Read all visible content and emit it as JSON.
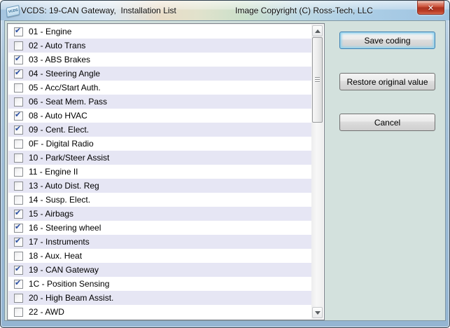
{
  "window": {
    "logo_text": "VCDS",
    "title": "VCDS: 19-CAN Gateway,  Installation List",
    "copyright": "Image Copyright (C) Ross-Tech, LLC",
    "close_glyph": "✕"
  },
  "list": {
    "items": [
      {
        "label": "01 - Engine",
        "checked": true
      },
      {
        "label": "02 - Auto Trans",
        "checked": false
      },
      {
        "label": "03 - ABS Brakes",
        "checked": true
      },
      {
        "label": "04 - Steering Angle",
        "checked": true
      },
      {
        "label": "05 - Acc/Start Auth.",
        "checked": false
      },
      {
        "label": "06 - Seat Mem. Pass",
        "checked": false
      },
      {
        "label": "08 - Auto HVAC",
        "checked": true
      },
      {
        "label": "09 - Cent. Elect.",
        "checked": true
      },
      {
        "label": "0F - Digital Radio",
        "checked": false
      },
      {
        "label": "10 - Park/Steer Assist",
        "checked": false
      },
      {
        "label": "11 - Engine II",
        "checked": false
      },
      {
        "label": "13 - Auto Dist. Reg",
        "checked": false
      },
      {
        "label": "14 - Susp. Elect.",
        "checked": false
      },
      {
        "label": "15 - Airbags",
        "checked": true
      },
      {
        "label": "16 - Steering wheel",
        "checked": true
      },
      {
        "label": "17 - Instruments",
        "checked": true
      },
      {
        "label": "18 - Aux. Heat",
        "checked": false
      },
      {
        "label": "19 - CAN Gateway",
        "checked": true
      },
      {
        "label": "1C - Position Sensing",
        "checked": true
      },
      {
        "label": "20 - High Beam Assist.",
        "checked": false
      },
      {
        "label": "22 - AWD",
        "checked": false
      }
    ],
    "partial_row_visible": true
  },
  "actions": {
    "save": "Save coding",
    "restore": "Restore original value",
    "cancel": "Cancel"
  },
  "colors": {
    "alt_row": "#e6e6f4",
    "client_bg": "#d3e1dd",
    "checkmark": "#2a4fa2",
    "close_button": "#c04a33",
    "default_button_glow": "#8fd2ee"
  }
}
